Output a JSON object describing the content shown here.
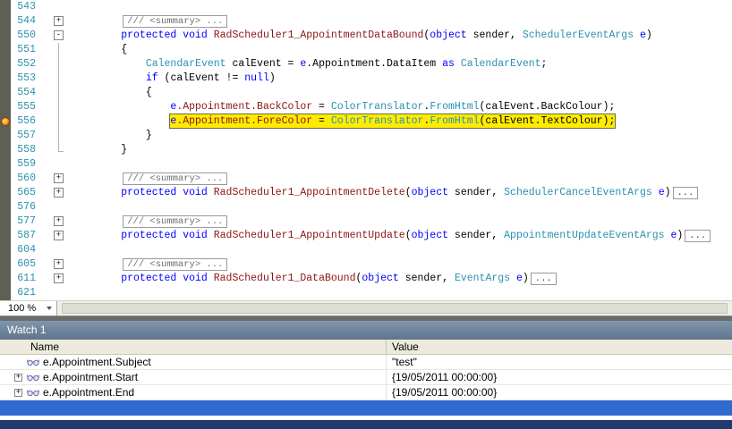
{
  "colors": {
    "margin_bg": "#5f5f55",
    "linenum": "#2b91af",
    "hl_bg": "#ffec00",
    "hl_border": "#6b6b4a",
    "select_bg": "#2f6ace",
    "title_bg1": "#8196ab",
    "title_bg2": "#5f758d",
    "header_bg": "#edeadd",
    "status_bg": "#203a6f"
  },
  "editor": {
    "zoom": "100 %",
    "token_colors": {
      "p": "#000000",
      "k": "#0000ff",
      "t": "#2b91af",
      "m": "#8b1515",
      "sum": "#6e6e6e",
      "box": "#3c3c3c"
    },
    "lines": [
      {
        "n": "543",
        "fold": "",
        "tokens": []
      },
      {
        "n": "544",
        "fold": "plus",
        "tokens": [
          [
            "p",
            "        "
          ],
          [
            "sum",
            "/// <summary> ..."
          ]
        ]
      },
      {
        "n": "550",
        "fold": "minus",
        "tokens": [
          [
            "p",
            "        "
          ],
          [
            "k",
            "protected void "
          ],
          [
            "m",
            "RadScheduler1_AppointmentDataBound"
          ],
          [
            "p",
            "("
          ],
          [
            "k",
            "object"
          ],
          [
            "p",
            " sender, "
          ],
          [
            "t",
            "SchedulerEventArgs"
          ],
          [
            "p",
            " "
          ],
          [
            "k",
            "e"
          ],
          [
            "p",
            ")"
          ]
        ]
      },
      {
        "n": "551",
        "fold": "line",
        "tokens": [
          [
            "p",
            "        {"
          ]
        ]
      },
      {
        "n": "552",
        "fold": "line",
        "tokens": [
          [
            "p",
            "            "
          ],
          [
            "t",
            "CalendarEvent"
          ],
          [
            "p",
            " calEvent = "
          ],
          [
            "k",
            "e"
          ],
          [
            "p",
            ".Appointment.DataItem "
          ],
          [
            "k",
            "as"
          ],
          [
            "p",
            " "
          ],
          [
            "t",
            "CalendarEvent"
          ],
          [
            "p",
            ";"
          ]
        ]
      },
      {
        "n": "553",
        "fold": "line",
        "tokens": [
          [
            "p",
            "            "
          ],
          [
            "k",
            "if"
          ],
          [
            "p",
            " (calEvent != "
          ],
          [
            "k",
            "null"
          ],
          [
            "p",
            ")"
          ]
        ]
      },
      {
        "n": "554",
        "fold": "line",
        "tokens": [
          [
            "p",
            "            {"
          ]
        ]
      },
      {
        "n": "555",
        "fold": "line",
        "tokens": [
          [
            "p",
            "                "
          ],
          [
            "k",
            "e"
          ],
          [
            "m",
            ".Appointment.BackColor"
          ],
          [
            "p",
            " = "
          ],
          [
            "t",
            "ColorTranslator"
          ],
          [
            "p",
            "."
          ],
          [
            "t",
            "FromHtml"
          ],
          [
            "p",
            "(calEvent.BackColour);"
          ]
        ]
      },
      {
        "n": "556",
        "fold": "line",
        "bp": true,
        "hl": true,
        "tokens": [
          [
            "p",
            "                "
          ],
          [
            "k",
            "e"
          ],
          [
            "m",
            ".Appointment.ForeColor"
          ],
          [
            "p",
            " = "
          ],
          [
            "t",
            "ColorTranslator"
          ],
          [
            "p",
            "."
          ],
          [
            "t",
            "FromHtml"
          ],
          [
            "p",
            "(calEvent.TextColour);"
          ]
        ]
      },
      {
        "n": "557",
        "fold": "line",
        "tokens": [
          [
            "p",
            "            }"
          ]
        ]
      },
      {
        "n": "558",
        "fold": "end",
        "tokens": [
          [
            "p",
            "        }"
          ]
        ]
      },
      {
        "n": "559",
        "fold": "",
        "tokens": []
      },
      {
        "n": "560",
        "fold": "plus",
        "tokens": [
          [
            "p",
            "        "
          ],
          [
            "sum",
            "/// <summary> ..."
          ]
        ]
      },
      {
        "n": "565",
        "fold": "plus",
        "tokens": [
          [
            "p",
            "        "
          ],
          [
            "k",
            "protected void "
          ],
          [
            "m",
            "RadScheduler1_AppointmentDelete"
          ],
          [
            "p",
            "("
          ],
          [
            "k",
            "object"
          ],
          [
            "p",
            " sender, "
          ],
          [
            "t",
            "SchedulerCancelEventArgs"
          ],
          [
            "p",
            " "
          ],
          [
            "k",
            "e"
          ],
          [
            "p",
            ")"
          ],
          [
            "box",
            "..."
          ]
        ]
      },
      {
        "n": "576",
        "fold": "",
        "tokens": []
      },
      {
        "n": "577",
        "fold": "plus",
        "tokens": [
          [
            "p",
            "        "
          ],
          [
            "sum",
            "/// <summary> ..."
          ]
        ]
      },
      {
        "n": "587",
        "fold": "plus",
        "tokens": [
          [
            "p",
            "        "
          ],
          [
            "k",
            "protected void "
          ],
          [
            "m",
            "RadScheduler1_AppointmentUpdate"
          ],
          [
            "p",
            "("
          ],
          [
            "k",
            "object"
          ],
          [
            "p",
            " sender, "
          ],
          [
            "t",
            "AppointmentUpdateEventArgs"
          ],
          [
            "p",
            " "
          ],
          [
            "k",
            "e"
          ],
          [
            "p",
            ")"
          ],
          [
            "box",
            "..."
          ]
        ]
      },
      {
        "n": "604",
        "fold": "",
        "tokens": []
      },
      {
        "n": "605",
        "fold": "plus",
        "tokens": [
          [
            "p",
            "        "
          ],
          [
            "sum",
            "/// <summary> ..."
          ]
        ]
      },
      {
        "n": "611",
        "fold": "plus",
        "tokens": [
          [
            "p",
            "        "
          ],
          [
            "k",
            "protected void "
          ],
          [
            "m",
            "RadScheduler1_DataBound"
          ],
          [
            "p",
            "("
          ],
          [
            "k",
            "object"
          ],
          [
            "p",
            " sender, "
          ],
          [
            "t",
            "EventArgs"
          ],
          [
            "p",
            " "
          ],
          [
            "k",
            "e"
          ],
          [
            "p",
            ")"
          ],
          [
            "box",
            "..."
          ]
        ]
      },
      {
        "n": "621",
        "fold": "",
        "tokens": []
      }
    ]
  },
  "watch": {
    "title": "Watch 1",
    "columns": [
      "Name",
      "Value"
    ],
    "rows": [
      {
        "icon": "watch-icon",
        "expand": false,
        "name": "e.Appointment.Subject",
        "value": "\"test\""
      },
      {
        "icon": "watch-icon",
        "expand": true,
        "name": "e.Appointment.Start",
        "value": "{19/05/2011 00:00:00}"
      },
      {
        "icon": "watch-icon",
        "expand": true,
        "name": "e.Appointment.End",
        "value": "{19/05/2011 00:00:00}"
      },
      {
        "empty": true,
        "selected": true
      }
    ]
  }
}
